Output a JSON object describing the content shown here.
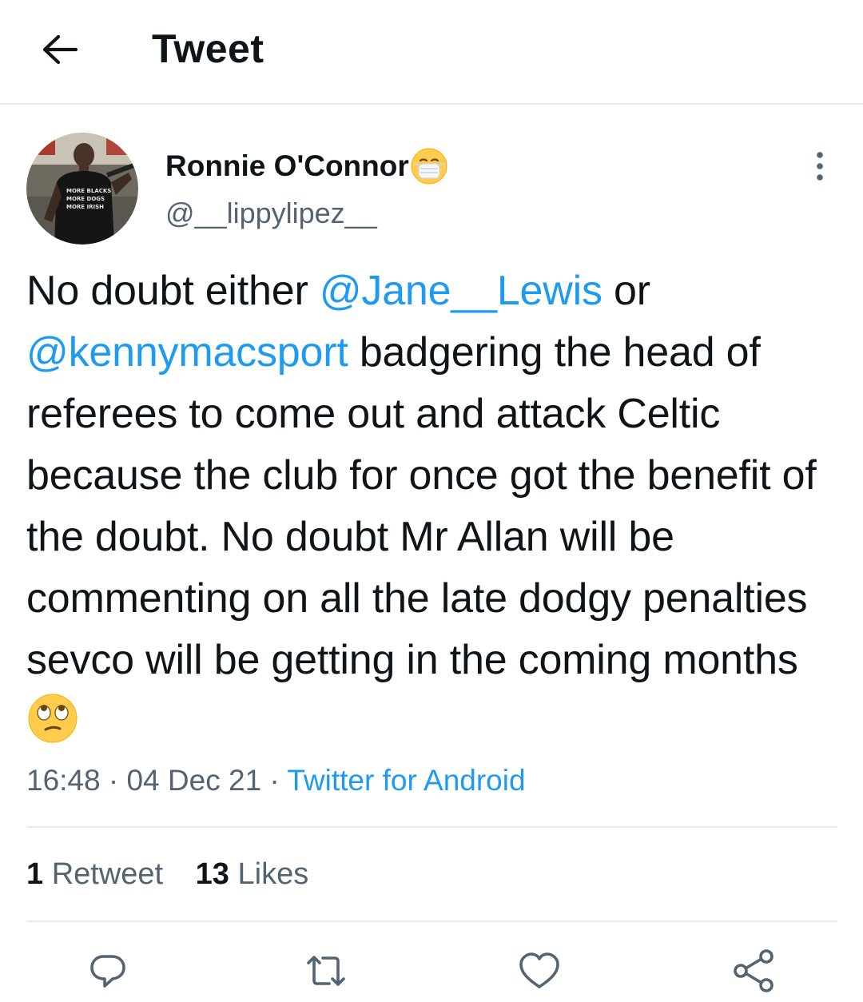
{
  "header": {
    "title": "Tweet",
    "back_icon": "arrow-left-icon"
  },
  "author": {
    "display_name": "Ronnie O'Connor",
    "name_emoji": "face-with-medical-mask-emoji",
    "handle": "@__lippylipez__",
    "avatar": "avatar-photo",
    "avatar_shirt_text": "MORE BLACKS MORE DOGS MORE IRISH"
  },
  "tweet": {
    "text_1": "No doubt either ",
    "mention_1": "@Jane__Lewis",
    "text_2": " or ",
    "mention_2": "@kennymacsport",
    "text_3": " badgering the head of referees to come out and attack Celtic because the club for once got the benefit of the doubt. No doubt Mr Allan will be commenting on all the late dodgy penalties sevco will be getting in the coming months",
    "trailing_emoji": "face-with-rolling-eyes-emoji"
  },
  "meta": {
    "time": "16:48",
    "sep1": " · ",
    "date": "04 Dec 21",
    "sep2": " · ",
    "source": "Twitter for Android"
  },
  "stats": {
    "retweets_count": "1",
    "retweets_label": "Retweet",
    "likes_count": "13",
    "likes_label": "Likes"
  },
  "actions": {
    "reply_icon": "reply-icon",
    "retweet_icon": "retweet-icon",
    "like_icon": "heart-icon",
    "share_icon": "share-icon"
  },
  "colors": {
    "accent": "#1d9bf0",
    "text": "#0f1419",
    "secondary": "#536471",
    "divider": "#e7e9ea"
  }
}
